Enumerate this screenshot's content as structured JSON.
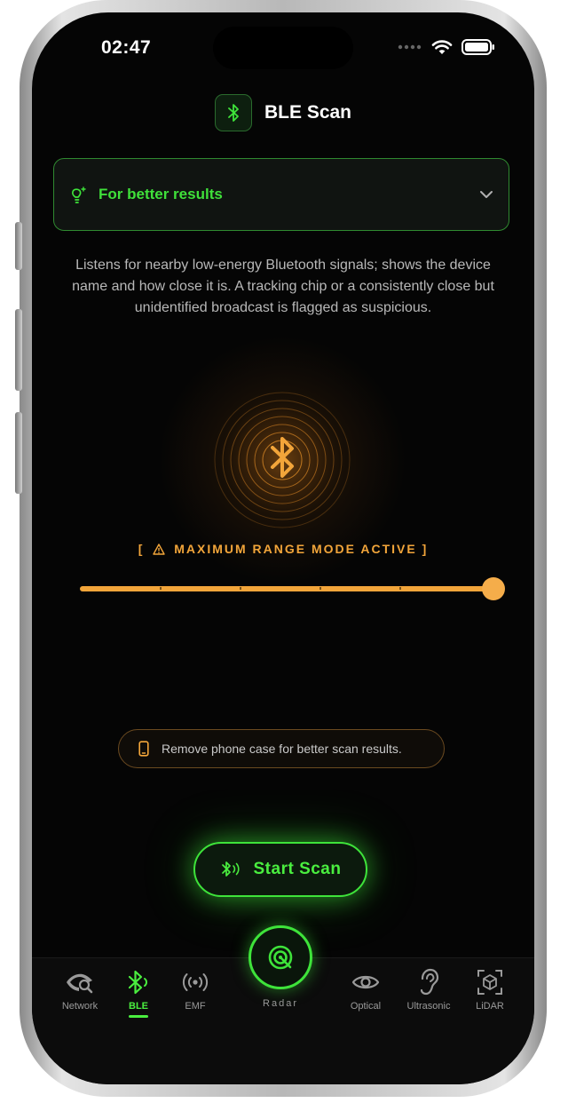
{
  "status_bar": {
    "time": "02:47"
  },
  "header": {
    "title": "BLE Scan",
    "icon": "bluetooth-icon"
  },
  "tips": {
    "label": "For better results",
    "icon": "lightbulb-icon",
    "expand_icon": "chevron-down-icon"
  },
  "description": "Listens for nearby low-energy Bluetooth signals; shows the device name and how close it is. A tracking chip or a consistently close but unidentified broadcast is flagged as suspicious.",
  "range": {
    "label": "MAXIMUM RANGE MODE ACTIVE",
    "open_bracket": "[",
    "close_bracket": "]",
    "level": 1.0,
    "steps": 5
  },
  "case_hint": {
    "text": "Remove phone case for better scan results.",
    "icon": "phone-icon"
  },
  "scan_button": {
    "label": "Start Scan",
    "icon": "bluetooth-scan-icon"
  },
  "tabs": [
    {
      "label": "Network",
      "icon": "eye-search-icon",
      "active": false
    },
    {
      "label": "BLE",
      "icon": "bluetooth-icon",
      "active": true
    },
    {
      "label": "EMF",
      "icon": "broadcast-icon",
      "active": false
    },
    {
      "label": "Radar",
      "icon": "radar-icon",
      "active": false
    },
    {
      "label": "Optical",
      "icon": "eye-icon",
      "active": false
    },
    {
      "label": "Ultrasonic",
      "icon": "ear-icon",
      "active": false
    },
    {
      "label": "LiDAR",
      "icon": "cube-scan-icon",
      "active": false
    }
  ],
  "colors": {
    "accent_green": "#3ee33a",
    "accent_orange": "#f2a53a",
    "background": "#050505"
  }
}
